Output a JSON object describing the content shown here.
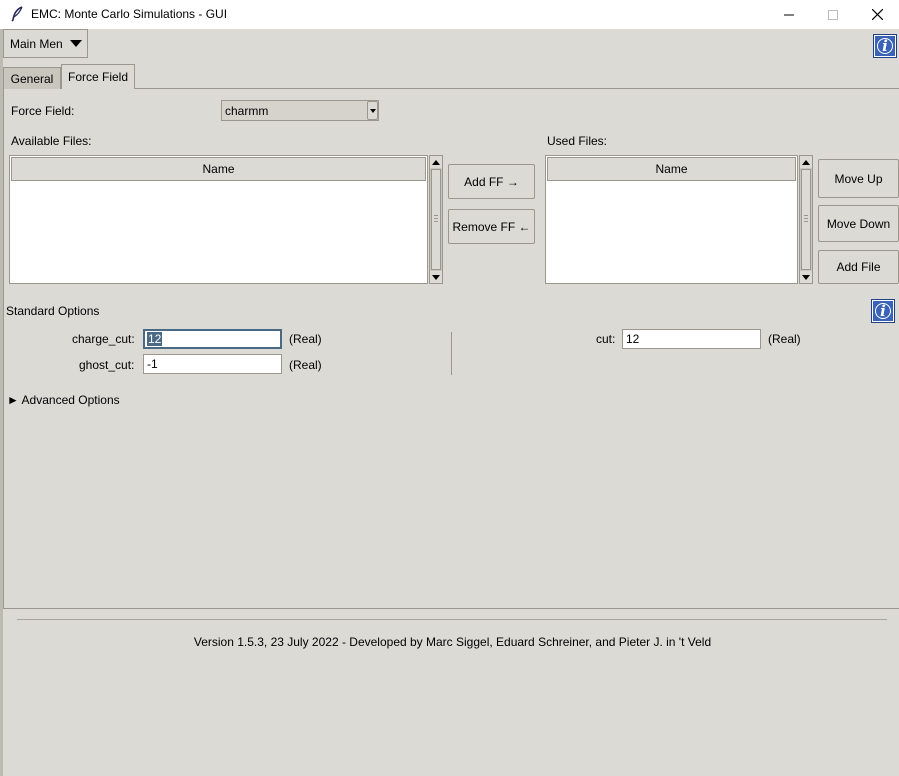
{
  "window": {
    "title": "EMC: Monte Carlo Simulations - GUI"
  },
  "menu": {
    "main_menu_label": "Main Men"
  },
  "tabs": [
    {
      "label": "General"
    },
    {
      "label": "Force Field"
    }
  ],
  "force_field": {
    "label": "Force Field:",
    "selected": "charmm",
    "available_label": "Available Files:",
    "used_label": "Used Files:",
    "available_column": "Name",
    "used_column": "Name",
    "available_items": [],
    "used_items": []
  },
  "buttons": {
    "add_ff": "Add FF →",
    "remove_ff": "Remove FF ←",
    "move_up": "Move Up",
    "move_down": "Move Down",
    "add_file": "Add File"
  },
  "standard_options": {
    "title": "Standard Options",
    "charge_cut": {
      "label": "charge_cut:",
      "value": "12",
      "unit": "(Real)"
    },
    "ghost_cut": {
      "label": "ghost_cut:",
      "value": "-1",
      "unit": "(Real)"
    },
    "cut": {
      "label": "cut:",
      "value": "12",
      "unit": "(Real)"
    }
  },
  "advanced": {
    "label": "► Advanced Options"
  },
  "footer": {
    "version": "Version 1.5.3, 23 July 2022 - Developed by Marc Siggel, Eduard Schreiner, and Pieter J. in 't Veld"
  },
  "icons": [
    "feather-icon",
    "minimize-icon",
    "maximize-icon",
    "close-icon",
    "info-icon"
  ]
}
